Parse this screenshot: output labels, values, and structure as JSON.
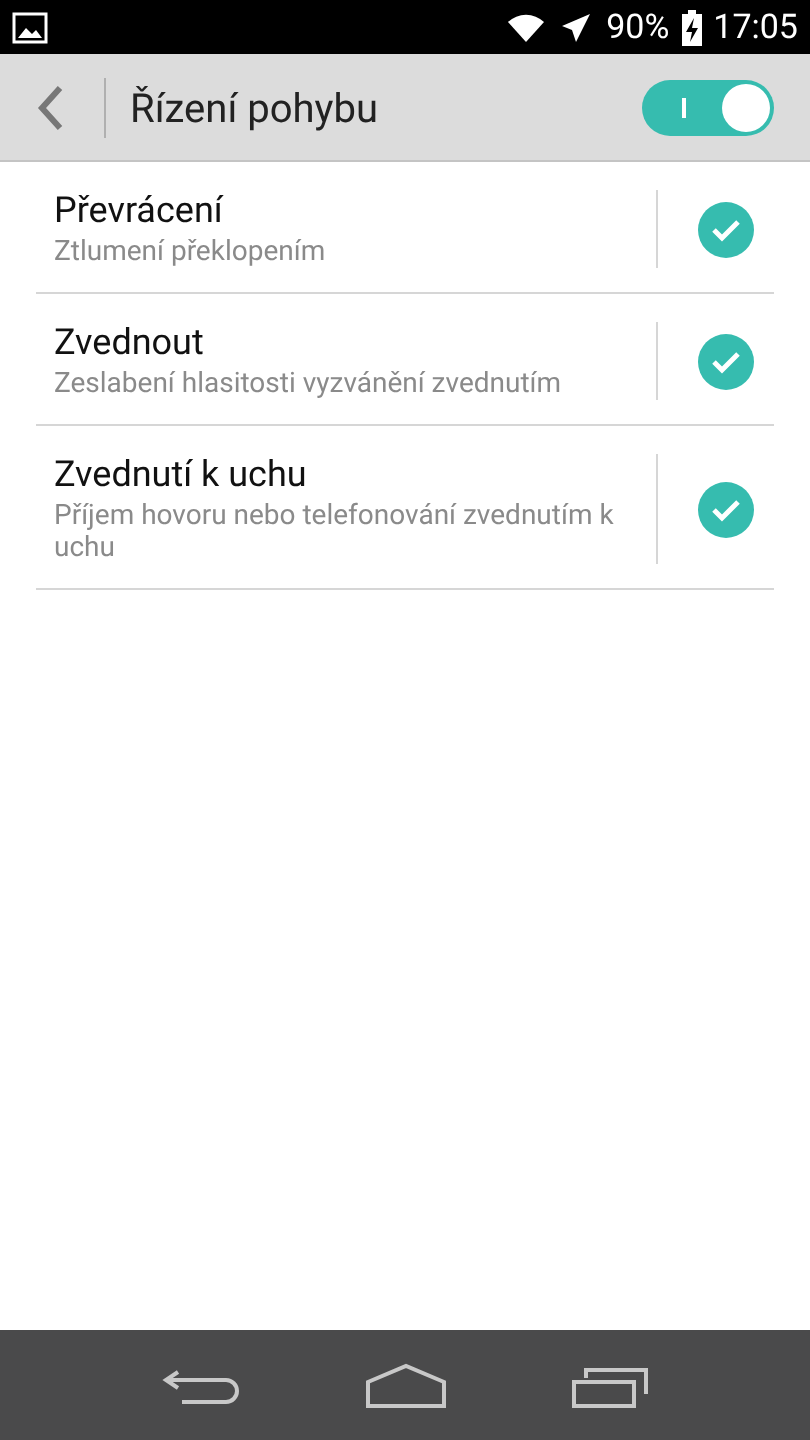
{
  "status_bar": {
    "battery": "90%",
    "time": "17:05"
  },
  "header": {
    "title": "Řízení pohybu",
    "toggle": {
      "on": true
    }
  },
  "items": [
    {
      "title": "Převrácení",
      "subtitle": "Ztlumení překlopením",
      "checked": true
    },
    {
      "title": "Zvednout",
      "subtitle": "Zeslabení hlasitosti vyzvánění zvednutím",
      "checked": true
    },
    {
      "title": "Zvednutí k uchu",
      "subtitle": "Příjem hovoru nebo telefonování zvednutím k uchu",
      "checked": true
    }
  ]
}
